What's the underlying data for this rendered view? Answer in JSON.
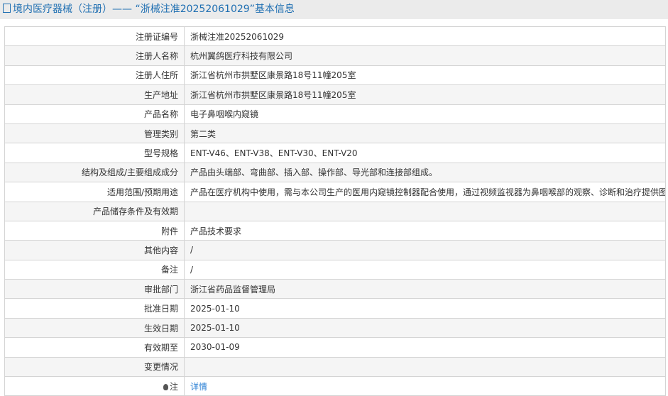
{
  "header": {
    "title": "境内医疗器械（注册）—— “浙械注准20252061029”基本信息"
  },
  "rows": [
    {
      "label": "注册证编号",
      "value": "浙械注准20252061029"
    },
    {
      "label": "注册人名称",
      "value": "杭州翼鸽医疗科技有限公司"
    },
    {
      "label": "注册人住所",
      "value": "浙江省杭州市拱墅区康景路18号11幢205室"
    },
    {
      "label": "生产地址",
      "value": "浙江省杭州市拱墅区康景路18号11幢205室"
    },
    {
      "label": "产品名称",
      "value": "电子鼻咽喉内窥镜"
    },
    {
      "label": "管理类别",
      "value": "第二类"
    },
    {
      "label": "型号规格",
      "value": "ENT-V46、ENT-V38、ENT-V30、ENT-V20"
    },
    {
      "label": "结构及组成/主要组成成分",
      "value": "产品由头端部、弯曲部、插入部、操作部、导光部和连接部组成。"
    },
    {
      "label": "适用范围/预期用途",
      "value": "产品在医疗机构中使用，需与本公司生产的医用内窥镜控制器配合使用，通过视频监视器为鼻咽喉部的观察、诊断和治疗提供图像。"
    },
    {
      "label": "产品储存条件及有效期",
      "value": ""
    },
    {
      "label": "附件",
      "value": "产品技术要求"
    },
    {
      "label": "其他内容",
      "value": "/"
    },
    {
      "label": "备注",
      "value": "/"
    },
    {
      "label": "审批部门",
      "value": "浙江省药品监督管理局"
    },
    {
      "label": "批准日期",
      "value": "2025-01-10"
    },
    {
      "label": "生效日期",
      "value": "2025-01-10"
    },
    {
      "label": "有效期至",
      "value": "2030-01-09"
    },
    {
      "label": "变更情况",
      "value": ""
    }
  ],
  "note": {
    "label": "注",
    "link": "详情"
  }
}
